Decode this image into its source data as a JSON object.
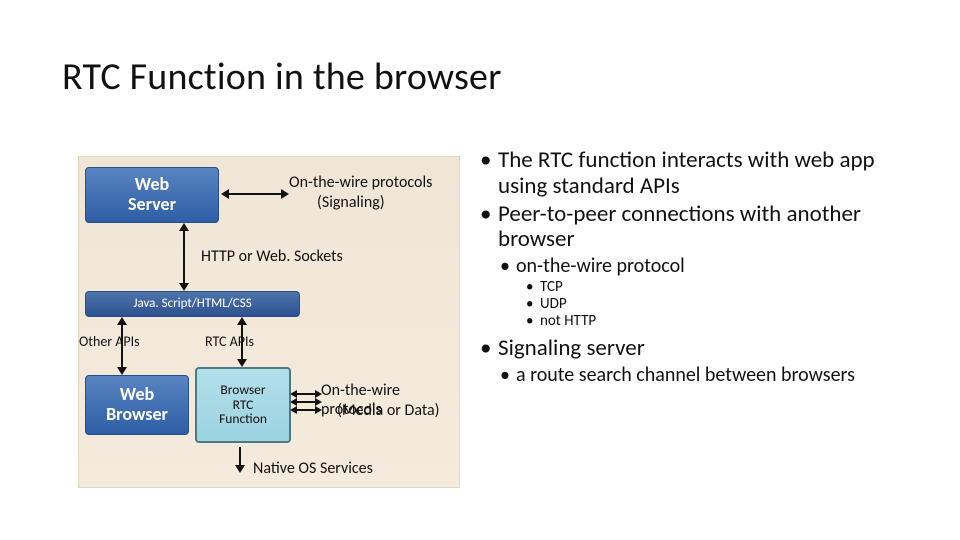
{
  "title": "RTC Function in the browser",
  "diagram": {
    "web_server": "Web\nServer",
    "js_html": "Java. Script/HTML/CSS",
    "web_browser": "Web\nBrowser",
    "rtc_func": "Browser\nRTC\nFunction",
    "sig_proto": "On-the-wire protocols",
    "sig_sub": "(Signaling)",
    "http_ws": "HTTP or Web. Sockets",
    "other_apis": "Other APIs",
    "rtc_apis": "RTC APIs",
    "media_proto": "On-the-wire protocols",
    "media_sub": "(Media or Data)",
    "native": "Native OS Services"
  },
  "bullets": {
    "b1": "The RTC function interacts with web app using standard APIs",
    "b2": "Peer-to-peer connections with another browser",
    "b2a": "on-the-wire protocol",
    "b2a1": "TCP",
    "b2a2": "UDP",
    "b2a3": "not HTTP",
    "b3": "Signaling server",
    "b3a": "a route search channel between browsers"
  }
}
